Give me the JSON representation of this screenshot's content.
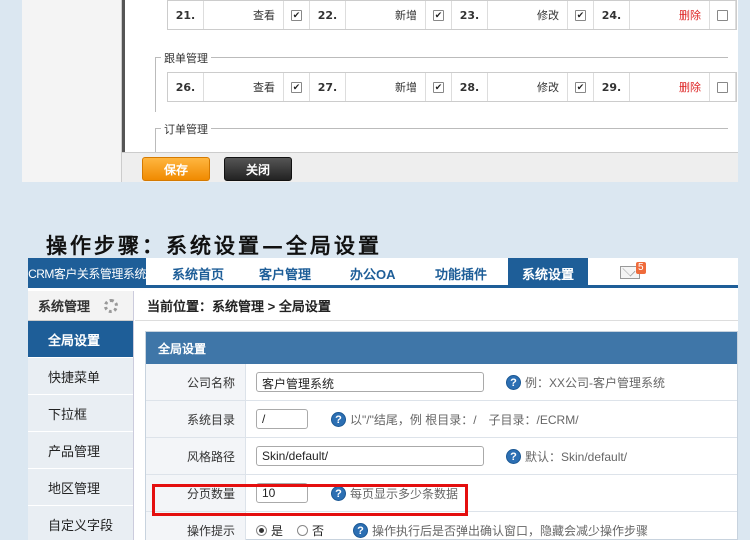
{
  "top": {
    "group_follow": "跟单管理",
    "group_order": "订单管理",
    "row1": [
      {
        "num": "21.",
        "action": "查看",
        "checked": true
      },
      {
        "num": "22.",
        "action": "新增",
        "checked": true
      },
      {
        "num": "23.",
        "action": "修改",
        "checked": true
      },
      {
        "num": "24.",
        "action": "删除",
        "checked": false
      }
    ],
    "row2": [
      {
        "num": "26.",
        "action": "查看",
        "checked": true
      },
      {
        "num": "27.",
        "action": "新增",
        "checked": true
      },
      {
        "num": "28.",
        "action": "修改",
        "checked": true
      },
      {
        "num": "29.",
        "action": "删除",
        "checked": false
      }
    ],
    "save_label": "保存",
    "close_label": "关闭"
  },
  "heading": "操作步骤：系统设置—全局设置",
  "app": {
    "brand": "CRM客户关系管理系统",
    "nav": [
      "系统首页",
      "客户管理",
      "办公OA",
      "功能插件",
      "系统设置"
    ],
    "mail_badge": "5",
    "sidebar_title": "系统管理",
    "sidebar_items": [
      "全局设置",
      "快捷菜单",
      "下拉框",
      "产品管理",
      "地区管理",
      "自定义字段"
    ],
    "breadcrumb": "当前位置：系统管理 > 全局设置",
    "panel_title": "全局设置",
    "fields": {
      "company_label": "公司名称",
      "company_value": "客户管理系统",
      "company_help": "例：XX公司-客户管理系统",
      "dir_label": "系统目录",
      "dir_value": "/",
      "dir_help": "以\"/\"结尾，例 根目录：/　子目录：/ECRM/",
      "style_label": "风格路径",
      "style_value": "Skin/default/",
      "style_help": "默认：Skin/default/",
      "page_label": "分页数量",
      "page_value": "10",
      "page_help": "每页显示多少条数据",
      "tip_label": "操作提示",
      "tip_yes": "是",
      "tip_no": "否",
      "tip_help": "操作执行后是否弹出确认窗口，隐藏会减少操作步骤"
    }
  },
  "colors": {
    "primary": "#1e5e98",
    "highlight": "#e40e0e",
    "save_button": "#f08a00"
  }
}
